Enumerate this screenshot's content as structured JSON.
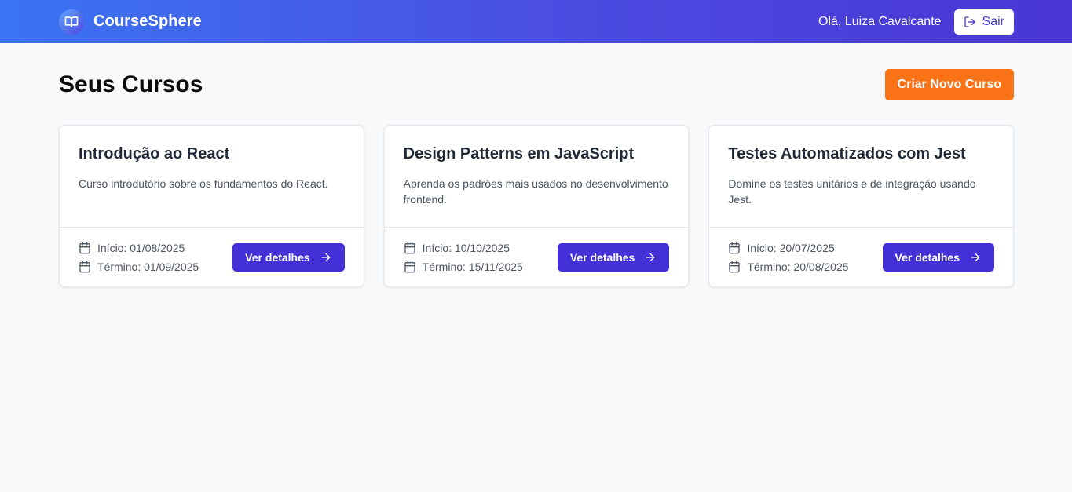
{
  "header": {
    "brand": "CourseSphere",
    "greeting": "Olá, Luiza Cavalcante",
    "logout_label": "Sair"
  },
  "main": {
    "title": "Seus Cursos",
    "create_label": "Criar Novo Curso",
    "courses": [
      {
        "title": "Introdução ao React",
        "description": "Curso introdutório sobre os fundamentos do React.",
        "start": "Início: 01/08/2025",
        "end": "Término: 01/09/2025",
        "details_label": "Ver detalhes"
      },
      {
        "title": "Design Patterns em JavaScript",
        "description": "Aprenda os padrões mais usados no desenvolvimento frontend.",
        "start": "Início: 10/10/2025",
        "end": "Término: 15/11/2025",
        "details_label": "Ver detalhes"
      },
      {
        "title": "Testes Automatizados com Jest",
        "description": "Domine os testes unitários e de integração usando Jest.",
        "start": "Início: 20/07/2025",
        "end": "Término: 20/08/2025",
        "details_label": "Ver detalhes"
      }
    ]
  },
  "icons": {
    "logo": "book-open-icon",
    "logout": "log-out-icon",
    "calendar": "calendar-icon",
    "arrow": "arrow-right-icon"
  },
  "colors": {
    "header_gradient_start": "#3b74f2",
    "header_gradient_end": "#4a35d6",
    "create_button": "#f97316",
    "details_button": "#4330d6"
  }
}
